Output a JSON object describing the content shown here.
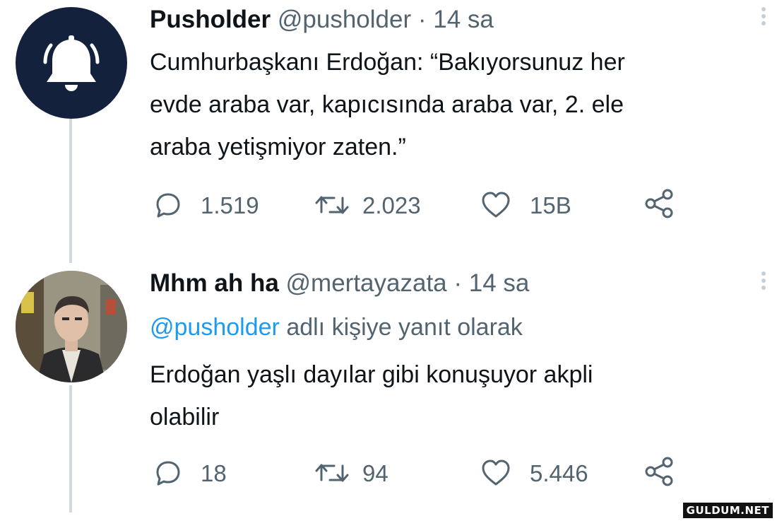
{
  "tweets": [
    {
      "display_name": "Pusholder",
      "handle": "@pusholder",
      "time": "· 14 sa",
      "text_lines": [
        "Cumhurbaşkanı Erdoğan: “Bakıyorsunuz her",
        "evde araba var, kapıcısında araba var, 2. ele",
        "araba yetişmiyor zaten.”"
      ],
      "stats": {
        "replies": "1.519",
        "retweets": "2.023",
        "likes": "15B"
      },
      "avatar_icon": "bell-icon",
      "avatar_color": "#14213d"
    },
    {
      "display_name": "Mhm ah ha",
      "handle": "@mertayazata",
      "time": "· 14 sa",
      "reply_to_handle": "@pusholder",
      "reply_to_text": "adlı kişiye yanıt olarak",
      "text_lines": [
        "Erdoğan yaşlı dayılar gibi konuşuyor akpli",
        "olabilir"
      ],
      "stats": {
        "replies": "18",
        "retweets": "94",
        "likes": "5.446"
      },
      "avatar_icon": "user-photo"
    }
  ],
  "watermark": "GULDUM.NET",
  "colors": {
    "text": "#0f1419",
    "secondary": "#536471",
    "link": "#1d9bf0",
    "thread_line": "#cfd9de"
  }
}
